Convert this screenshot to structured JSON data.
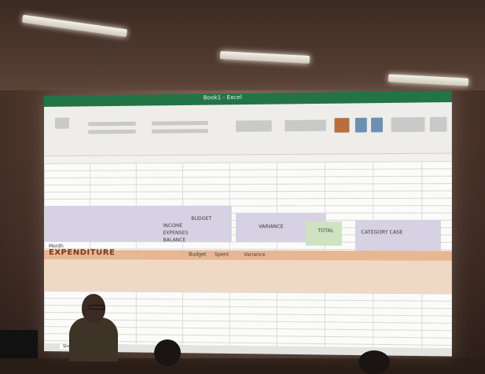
{
  "spreadsheet": {
    "window_title": "Book1 - Excel",
    "sheet_tab": "Sheet1",
    "cells": {
      "budget_header": "BUDGET",
      "variance_header": "VARIANCE",
      "total_header": "TOTAL",
      "category_header": "CATEGORY CASE",
      "row_labels": [
        "INCOME",
        "EXPENSES",
        "BALANCE"
      ],
      "expenditure_heading": "EXPENDITURE",
      "month_label": "Month",
      "col_labels": [
        "Budget",
        "Spent",
        "Variance"
      ]
    }
  },
  "colors": {
    "excel_green": "#227447",
    "band_purple": "#d6d2e3",
    "band_green": "#cfe3c3",
    "band_orange": "#e7b792",
    "band_peach": "#f0d9c4"
  }
}
